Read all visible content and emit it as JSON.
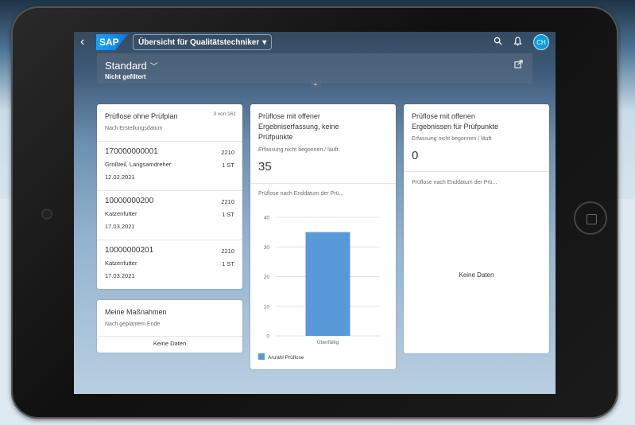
{
  "shell": {
    "app_title": "Übersicht für Qualitätstechniker",
    "logo": "SAP",
    "avatar_initials": "CH",
    "icons": [
      "back-icon",
      "search-icon",
      "bell-icon",
      "share-icon"
    ]
  },
  "header": {
    "variant": "Standard",
    "filter_status": "Nicht gefiltert"
  },
  "card1": {
    "title": "Prüflose ohne Prüfplan",
    "count": "3 von 161",
    "subtitle": "Nach Erstellungsdatum",
    "items": [
      {
        "id": "170000000001",
        "desc": "Großteil, Langsamdreher",
        "date": "12.02.2021",
        "plant": "2210",
        "qty": "1 ST"
      },
      {
        "id": "10000000200",
        "desc": "Katzenfutter",
        "date": "17.03.2021",
        "plant": "2210",
        "qty": "1 ST"
      },
      {
        "id": "10000000201",
        "desc": "Katzenfutter",
        "date": "17.03.2021",
        "plant": "2210",
        "qty": "1 ST"
      }
    ]
  },
  "card2": {
    "title": "Meine Maßnahmen",
    "subtitle": "Nach geplantem Ende",
    "nodata": "Keine Daten"
  },
  "card3": {
    "title_l1": "Prüflose mit offener",
    "title_l2": "Ergebniserfassung, keine",
    "title_l3": "Prüfpunkte",
    "subtitle": "Erfassung nicht begonnen / läuft",
    "kpi": "35",
    "chart_title": "Prüflose nach Enddatum der Prü...",
    "legend": "Anzahl Prüflose"
  },
  "card4": {
    "title_l1": "Prüflose mit offenen",
    "title_l2": "Ergebnissen für Prüfpunkte",
    "subtitle": "Erfassung nicht begonnen / läuft",
    "kpi": "0",
    "chart_title": "Prüflose nach Enddatum der Prü...",
    "nodata": "Keine Daten"
  },
  "colors": {
    "accent": "#0a6ed1",
    "bar": "#5899da",
    "shell": "#354a5f"
  },
  "chart_data": {
    "type": "bar",
    "categories": [
      "Überfällig"
    ],
    "series": [
      {
        "name": "Anzahl Prüflose",
        "values": [
          35
        ]
      }
    ],
    "yticks": [
      0,
      10,
      20,
      30,
      40
    ],
    "ylim": [
      0,
      40
    ],
    "title": "Prüflose nach Enddatum der Prü...",
    "legend": "bottom-left",
    "grid": true
  }
}
